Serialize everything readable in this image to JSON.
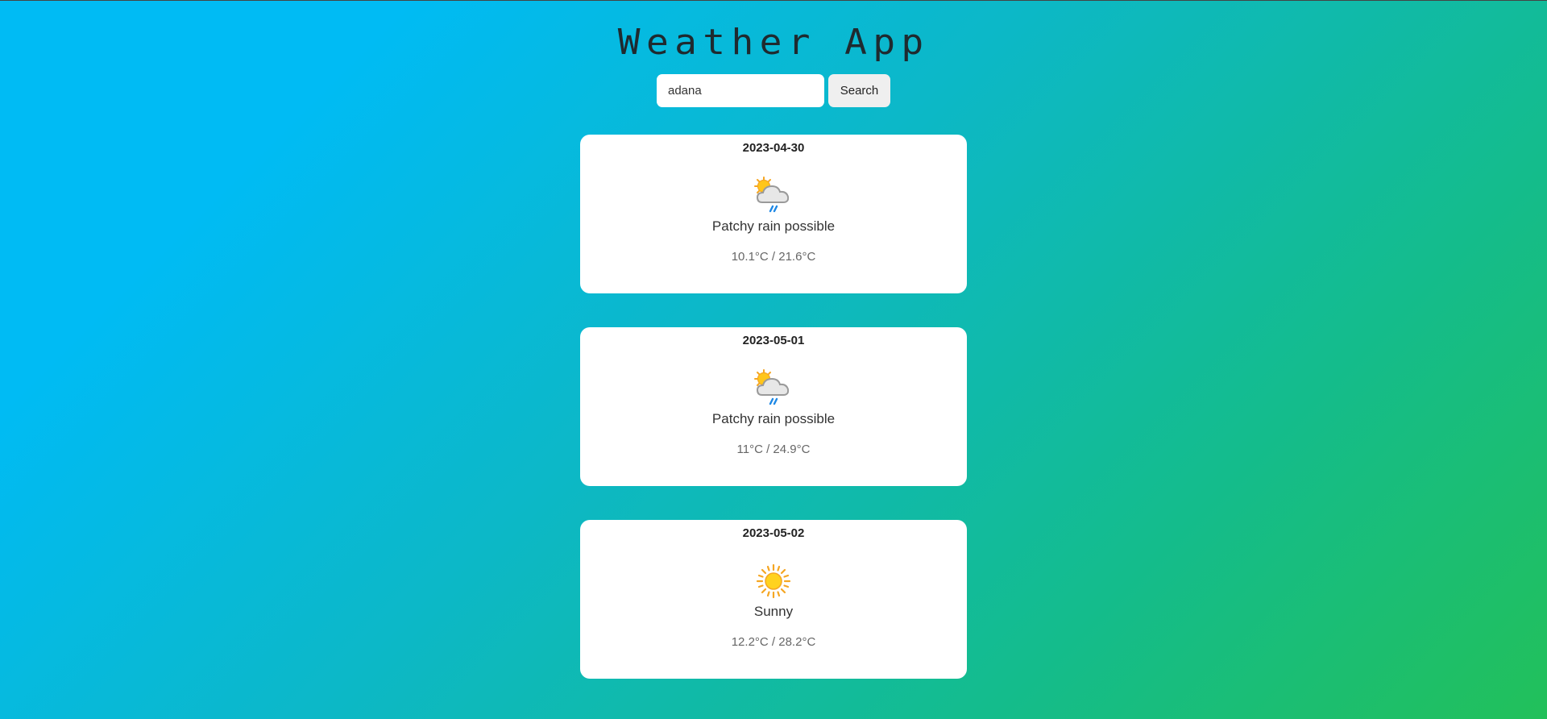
{
  "app": {
    "title": "Weather App"
  },
  "search": {
    "value": "adana",
    "placeholder": "",
    "button_label": "Search"
  },
  "forecast": [
    {
      "date": "2023-04-30",
      "icon": "patchy-rain-icon",
      "condition": "Patchy rain possible",
      "temps": "10.1°C / 21.6°C"
    },
    {
      "date": "2023-05-01",
      "icon": "patchy-rain-icon",
      "condition": "Patchy rain possible",
      "temps": "11°C / 24.9°C"
    },
    {
      "date": "2023-05-02",
      "icon": "sunny-icon",
      "condition": "Sunny",
      "temps": "12.2°C / 28.2°C"
    }
  ],
  "colors": {
    "background_start": "#00bbf4",
    "background_end": "#22c05a",
    "card_background": "#ffffff",
    "sun": "#ffc107",
    "rain": "#1e88e5"
  }
}
